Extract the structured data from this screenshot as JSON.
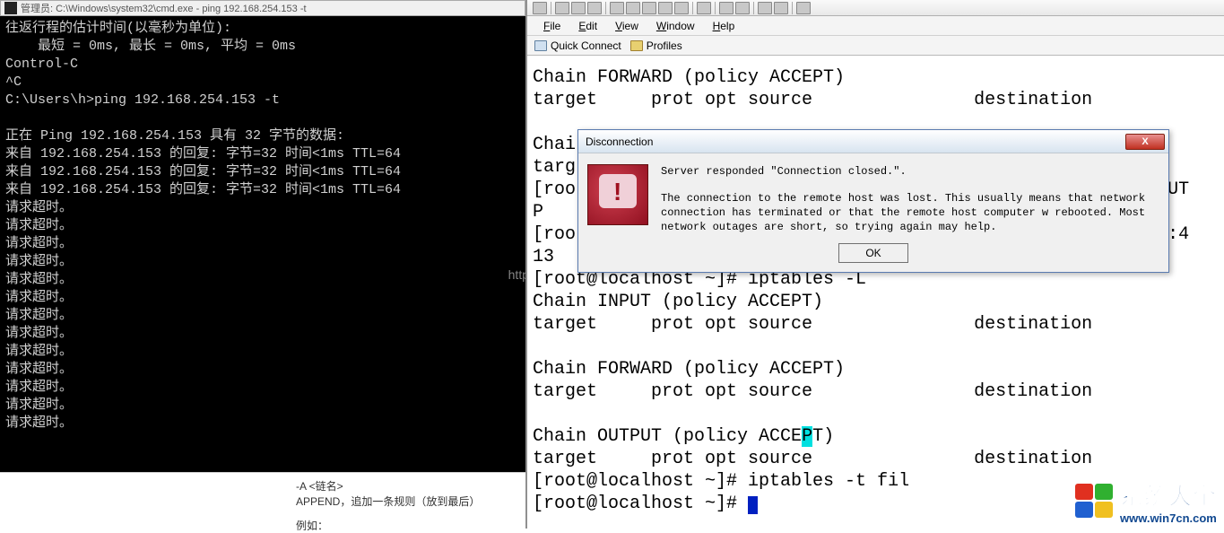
{
  "cmd": {
    "title": "管理员: C:\\Windows\\system32\\cmd.exe - ping  192.168.254.153 -t",
    "lines": [
      "往返行程的估计时间(以毫秒为单位):",
      "    最短 = 0ms, 最长 = 0ms, 平均 = 0ms",
      "Control-C",
      "^C",
      "C:\\Users\\h>ping 192.168.254.153 -t",
      "",
      "正在 Ping 192.168.254.153 具有 32 字节的数据:",
      "来自 192.168.254.153 的回复: 字节=32 时间<1ms TTL=64",
      "来自 192.168.254.153 的回复: 字节=32 时间<1ms TTL=64",
      "来自 192.168.254.153 的回复: 字节=32 时间<1ms TTL=64",
      "请求超时。",
      "请求超时。",
      "请求超时。",
      "请求超时。",
      "请求超时。",
      "请求超时。",
      "请求超时。",
      "请求超时。",
      "请求超时。",
      "请求超时。",
      "请求超时。",
      "请求超时。",
      "请求超时。"
    ],
    "lower": {
      "l1": "-A <链名>",
      "l2": "APPEND，追加一条规则（放到最后）",
      "l3": "例如："
    },
    "watermark": "http"
  },
  "ssh": {
    "menu": {
      "file": "File",
      "edit": "Edit",
      "view": "View",
      "window": "Window",
      "help": "Help"
    },
    "quickbar": {
      "quick_connect": "Quick Connect",
      "profiles": "Profiles"
    },
    "terminal": {
      "l1": "Chain FORWARD (policy ACCEPT)",
      "l2": "target     prot opt source               destination",
      "l3": "",
      "l4": "Chai",
      "l5": "targ                                                     n",
      "l6": "[roo                                                     NPUT",
      "l7": "P",
      "l8": "[roo                                                     16:4",
      "l9": "13",
      "l10": "[root@localhost ~]# iptables -L",
      "l11": "Chain INPUT (policy ACCEPT)",
      "l12": "target     prot opt source               destination",
      "l13": "",
      "l14": "Chain FORWARD (policy ACCEPT)",
      "l15": "target     prot opt source               destination",
      "l16": "",
      "l17a": "Chain OUTPUT (policy ACCE",
      "l17b": "P",
      "l17c": "T)",
      "l18": "target     prot opt source               destination",
      "l19": "[root@localhost ~]# iptables -t fil",
      "l20": "[root@localhost ~]# "
    }
  },
  "dialog": {
    "title": "Disconnection",
    "main_msg": "Server responded \"Connection closed.\".",
    "body_msg": "The connection to the remote host was lost.  This usually means that network connection has terminated or that the remote host computer w rebooted.  Most network outages are short, so trying again may help.",
    "ok_label": "OK",
    "close_label": "X"
  },
  "watermark_logo": {
    "main": "系统大全",
    "sub": "www.win7cn.com"
  }
}
